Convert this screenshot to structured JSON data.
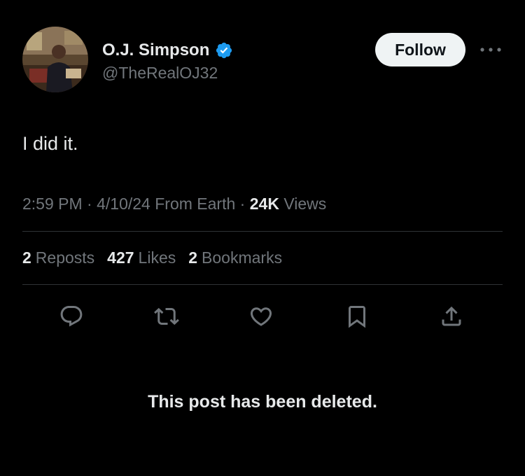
{
  "author": {
    "display_name": "O.J. Simpson",
    "handle": "@TheRealOJ32",
    "verified": true,
    "verified_color": "#1d9bf0",
    "avatar_icon": "profile-photo"
  },
  "header": {
    "follow_label": "Follow",
    "more_icon": "more-horizontal-icon"
  },
  "tweet": {
    "text": "I did it.",
    "time": "2:59 PM",
    "date": "4/10/24",
    "source": "From Earth",
    "views_count": "24K",
    "views_label": "Views",
    "separator": "·"
  },
  "stats": {
    "reposts_count": "2",
    "reposts_label": "Reposts",
    "likes_count": "427",
    "likes_label": "Likes",
    "bookmarks_count": "2",
    "bookmarks_label": "Bookmarks"
  },
  "actions": [
    "reply-icon",
    "repost-icon",
    "like-icon",
    "bookmark-icon",
    "share-icon"
  ],
  "notice": {
    "deleted_text": "This post has been deleted."
  },
  "colors": {
    "background": "#000000",
    "primary_text": "#e7e9ea",
    "secondary_text": "#71767b",
    "divider": "#2f3336",
    "follow_bg": "#eff3f4"
  }
}
